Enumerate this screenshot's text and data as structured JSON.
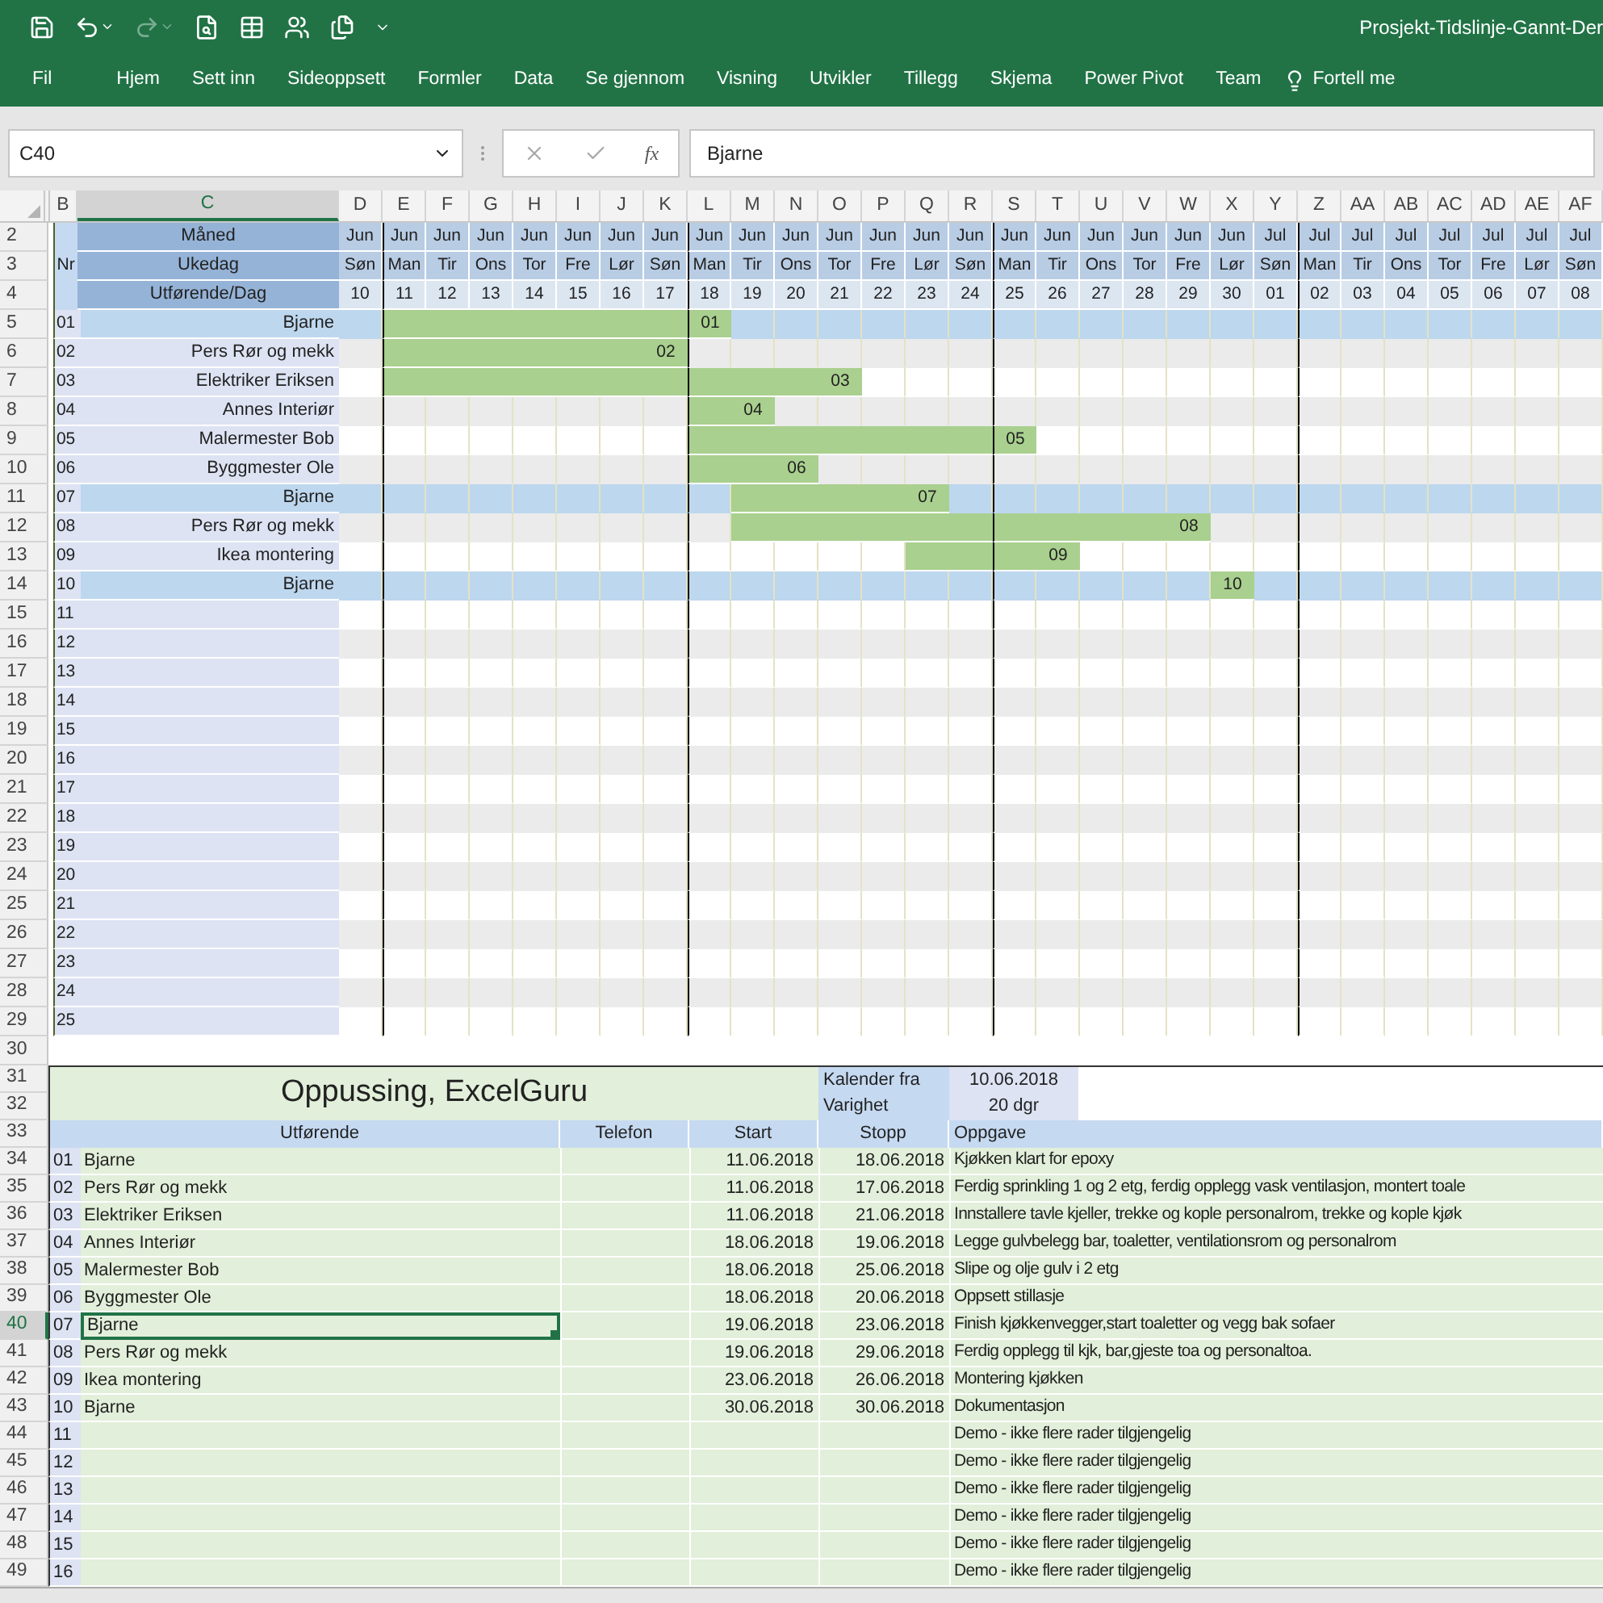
{
  "window": {
    "title": "Prosjekt-Tidslinje-Gannt-Der"
  },
  "quick_access": {
    "redo": {
      "disabled": true
    }
  },
  "ribbon_tabs": [
    {
      "label": "Fil"
    },
    {
      "label": "Hjem"
    },
    {
      "label": "Sett inn"
    },
    {
      "label": "Sideoppsett"
    },
    {
      "label": "Formler"
    },
    {
      "label": "Data"
    },
    {
      "label": "Se gjennom"
    },
    {
      "label": "Visning"
    },
    {
      "label": "Utvikler"
    },
    {
      "label": "Tillegg"
    },
    {
      "label": "Skjema"
    },
    {
      "label": "Power Pivot"
    },
    {
      "label": "Team"
    }
  ],
  "tell_me": "Fortell me",
  "formula_bar": {
    "name_box": "C40",
    "function_label": "fx",
    "value": "Bjarne"
  },
  "column_headers": [
    {
      "label": "B",
      "selected": false
    },
    {
      "label": "C",
      "selected": true
    },
    {
      "label": "D",
      "selected": false
    },
    {
      "label": "E",
      "selected": false
    },
    {
      "label": "F",
      "selected": false
    },
    {
      "label": "G",
      "selected": false
    },
    {
      "label": "H",
      "selected": false
    },
    {
      "label": "I",
      "selected": false
    },
    {
      "label": "J",
      "selected": false
    },
    {
      "label": "K",
      "selected": false
    },
    {
      "label": "L",
      "selected": false
    },
    {
      "label": "M",
      "selected": false
    },
    {
      "label": "N",
      "selected": false
    },
    {
      "label": "O",
      "selected": false
    },
    {
      "label": "P",
      "selected": false
    },
    {
      "label": "Q",
      "selected": false
    },
    {
      "label": "R",
      "selected": false
    },
    {
      "label": "S",
      "selected": false
    },
    {
      "label": "T",
      "selected": false
    },
    {
      "label": "U",
      "selected": false
    },
    {
      "label": "V",
      "selected": false
    },
    {
      "label": "W",
      "selected": false
    },
    {
      "label": "X",
      "selected": false
    },
    {
      "label": "Y",
      "selected": false
    },
    {
      "label": "Z",
      "selected": false
    },
    {
      "label": "AA",
      "selected": false
    },
    {
      "label": "AB",
      "selected": false
    },
    {
      "label": "AC",
      "selected": false
    },
    {
      "label": "AD",
      "selected": false
    },
    {
      "label": "AE",
      "selected": false
    },
    {
      "label": "AF",
      "selected": false
    }
  ],
  "row_headers": [
    {
      "label": "2",
      "selected": false
    },
    {
      "label": "3",
      "selected": false
    },
    {
      "label": "4",
      "selected": false
    },
    {
      "label": "5",
      "selected": false
    },
    {
      "label": "6",
      "selected": false
    },
    {
      "label": "7",
      "selected": false
    },
    {
      "label": "8",
      "selected": false
    },
    {
      "label": "9",
      "selected": false
    },
    {
      "label": "10",
      "selected": false
    },
    {
      "label": "11",
      "selected": false
    },
    {
      "label": "12",
      "selected": false
    },
    {
      "label": "13",
      "selected": false
    },
    {
      "label": "14",
      "selected": false
    },
    {
      "label": "15",
      "selected": false
    },
    {
      "label": "16",
      "selected": false
    },
    {
      "label": "17",
      "selected": false
    },
    {
      "label": "18",
      "selected": false
    },
    {
      "label": "19",
      "selected": false
    },
    {
      "label": "20",
      "selected": false
    },
    {
      "label": "21",
      "selected": false
    },
    {
      "label": "22",
      "selected": false
    },
    {
      "label": "23",
      "selected": false
    },
    {
      "label": "24",
      "selected": false
    },
    {
      "label": "25",
      "selected": false
    },
    {
      "label": "26",
      "selected": false
    },
    {
      "label": "27",
      "selected": false
    },
    {
      "label": "28",
      "selected": false
    },
    {
      "label": "29",
      "selected": false
    },
    {
      "label": "30",
      "selected": false
    },
    {
      "label": "31",
      "selected": false
    },
    {
      "label": "32",
      "selected": false
    },
    {
      "label": "33",
      "selected": false
    },
    {
      "label": "34",
      "selected": false
    },
    {
      "label": "35",
      "selected": false
    },
    {
      "label": "36",
      "selected": false
    },
    {
      "label": "37",
      "selected": false
    },
    {
      "label": "38",
      "selected": false
    },
    {
      "label": "39",
      "selected": false
    },
    {
      "label": "40",
      "selected": true
    },
    {
      "label": "41",
      "selected": false
    },
    {
      "label": "42",
      "selected": false
    },
    {
      "label": "43",
      "selected": false
    },
    {
      "label": "44",
      "selected": false
    },
    {
      "label": "45",
      "selected": false
    },
    {
      "label": "46",
      "selected": false
    },
    {
      "label": "47",
      "selected": false
    },
    {
      "label": "48",
      "selected": false
    },
    {
      "label": "49",
      "selected": false
    }
  ],
  "gantt": {
    "nr_label": "Nr",
    "month_label": "Måned",
    "weekday_label": "Ukedag",
    "day_label": "Utførende/Dag",
    "days": [
      {
        "month": "Jun",
        "weekday": "Søn",
        "day": "10",
        "week_start": false
      },
      {
        "month": "Jun",
        "weekday": "Man",
        "day": "11",
        "week_start": true
      },
      {
        "month": "Jun",
        "weekday": "Tir",
        "day": "12",
        "week_start": false
      },
      {
        "month": "Jun",
        "weekday": "Ons",
        "day": "13",
        "week_start": false
      },
      {
        "month": "Jun",
        "weekday": "Tor",
        "day": "14",
        "week_start": false
      },
      {
        "month": "Jun",
        "weekday": "Fre",
        "day": "15",
        "week_start": false
      },
      {
        "month": "Jun",
        "weekday": "Lør",
        "day": "16",
        "week_start": false
      },
      {
        "month": "Jun",
        "weekday": "Søn",
        "day": "17",
        "week_start": false
      },
      {
        "month": "Jun",
        "weekday": "Man",
        "day": "18",
        "week_start": true
      },
      {
        "month": "Jun",
        "weekday": "Tir",
        "day": "19",
        "week_start": false
      },
      {
        "month": "Jun",
        "weekday": "Ons",
        "day": "20",
        "week_start": false
      },
      {
        "month": "Jun",
        "weekday": "Tor",
        "day": "21",
        "week_start": false
      },
      {
        "month": "Jun",
        "weekday": "Fre",
        "day": "22",
        "week_start": false
      },
      {
        "month": "Jun",
        "weekday": "Lør",
        "day": "23",
        "week_start": false
      },
      {
        "month": "Jun",
        "weekday": "Søn",
        "day": "24",
        "week_start": false
      },
      {
        "month": "Jun",
        "weekday": "Man",
        "day": "25",
        "week_start": true
      },
      {
        "month": "Jun",
        "weekday": "Tir",
        "day": "26",
        "week_start": false
      },
      {
        "month": "Jun",
        "weekday": "Ons",
        "day": "27",
        "week_start": false
      },
      {
        "month": "Jun",
        "weekday": "Tor",
        "day": "28",
        "week_start": false
      },
      {
        "month": "Jun",
        "weekday": "Fre",
        "day": "29",
        "week_start": false
      },
      {
        "month": "Jun",
        "weekday": "Lør",
        "day": "30",
        "week_start": false
      },
      {
        "month": "Jul",
        "weekday": "Søn",
        "day": "01",
        "week_start": false
      },
      {
        "month": "Jul",
        "weekday": "Man",
        "day": "02",
        "week_start": true
      },
      {
        "month": "Jul",
        "weekday": "Tir",
        "day": "03",
        "week_start": false
      },
      {
        "month": "Jul",
        "weekday": "Ons",
        "day": "04",
        "week_start": false
      },
      {
        "month": "Jul",
        "weekday": "Tor",
        "day": "05",
        "week_start": false
      },
      {
        "month": "Jul",
        "weekday": "Fre",
        "day": "06",
        "week_start": false
      },
      {
        "month": "Jul",
        "weekday": "Lør",
        "day": "07",
        "week_start": false
      },
      {
        "month": "Jul",
        "weekday": "Søn",
        "day": "08",
        "week_start": false
      }
    ],
    "rows": [
      {
        "nr": "01",
        "name": "Bjarne",
        "highlighted": true,
        "bar_label": "01",
        "filled": [
          false,
          true,
          true,
          true,
          true,
          true,
          true,
          true,
          true,
          false,
          false,
          false,
          false,
          false,
          false,
          false,
          false,
          false,
          false,
          false,
          false,
          false,
          false,
          false,
          false,
          false,
          false,
          false,
          false
        ]
      },
      {
        "nr": "02",
        "name": "Pers Rør og mekk",
        "highlighted": false,
        "bar_label": "02",
        "filled": [
          false,
          true,
          true,
          true,
          true,
          true,
          true,
          true,
          false,
          false,
          false,
          false,
          false,
          false,
          false,
          false,
          false,
          false,
          false,
          false,
          false,
          false,
          false,
          false,
          false,
          false,
          false,
          false,
          false
        ]
      },
      {
        "nr": "03",
        "name": "Elektriker Eriksen",
        "highlighted": false,
        "bar_label": "03",
        "filled": [
          false,
          true,
          true,
          true,
          true,
          true,
          true,
          true,
          true,
          true,
          true,
          true,
          false,
          false,
          false,
          false,
          false,
          false,
          false,
          false,
          false,
          false,
          false,
          false,
          false,
          false,
          false,
          false,
          false
        ]
      },
      {
        "nr": "04",
        "name": "Annes Interiør",
        "highlighted": false,
        "bar_label": "04",
        "filled": [
          false,
          false,
          false,
          false,
          false,
          false,
          false,
          false,
          true,
          true,
          false,
          false,
          false,
          false,
          false,
          false,
          false,
          false,
          false,
          false,
          false,
          false,
          false,
          false,
          false,
          false,
          false,
          false,
          false
        ]
      },
      {
        "nr": "05",
        "name": "Malermester Bob",
        "highlighted": false,
        "bar_label": "05",
        "filled": [
          false,
          false,
          false,
          false,
          false,
          false,
          false,
          false,
          true,
          true,
          true,
          true,
          true,
          true,
          true,
          true,
          false,
          false,
          false,
          false,
          false,
          false,
          false,
          false,
          false,
          false,
          false,
          false,
          false
        ]
      },
      {
        "nr": "06",
        "name": "Byggmester Ole",
        "highlighted": false,
        "bar_label": "06",
        "filled": [
          false,
          false,
          false,
          false,
          false,
          false,
          false,
          false,
          true,
          true,
          true,
          false,
          false,
          false,
          false,
          false,
          false,
          false,
          false,
          false,
          false,
          false,
          false,
          false,
          false,
          false,
          false,
          false,
          false
        ]
      },
      {
        "nr": "07",
        "name": "Bjarne",
        "highlighted": true,
        "bar_label": "07",
        "filled": [
          false,
          false,
          false,
          false,
          false,
          false,
          false,
          false,
          false,
          true,
          true,
          true,
          true,
          true,
          false,
          false,
          false,
          false,
          false,
          false,
          false,
          false,
          false,
          false,
          false,
          false,
          false,
          false,
          false
        ]
      },
      {
        "nr": "08",
        "name": "Pers Rør og mekk",
        "highlighted": false,
        "bar_label": "08",
        "filled": [
          false,
          false,
          false,
          false,
          false,
          false,
          false,
          false,
          false,
          true,
          true,
          true,
          true,
          true,
          true,
          true,
          true,
          true,
          true,
          true,
          false,
          false,
          false,
          false,
          false,
          false,
          false,
          false,
          false
        ]
      },
      {
        "nr": "09",
        "name": "Ikea montering",
        "highlighted": false,
        "bar_label": "09",
        "filled": [
          false,
          false,
          false,
          false,
          false,
          false,
          false,
          false,
          false,
          false,
          false,
          false,
          false,
          true,
          true,
          true,
          true,
          false,
          false,
          false,
          false,
          false,
          false,
          false,
          false,
          false,
          false,
          false,
          false
        ]
      },
      {
        "nr": "10",
        "name": "Bjarne",
        "highlighted": true,
        "bar_label": "10",
        "filled": [
          false,
          false,
          false,
          false,
          false,
          false,
          false,
          false,
          false,
          false,
          false,
          false,
          false,
          false,
          false,
          false,
          false,
          false,
          false,
          false,
          true,
          false,
          false,
          false,
          false,
          false,
          false,
          false,
          false
        ]
      },
      {
        "nr": "11",
        "highlighted": false
      },
      {
        "nr": "12",
        "highlighted": false
      },
      {
        "nr": "13",
        "highlighted": false
      },
      {
        "nr": "14",
        "highlighted": false
      },
      {
        "nr": "15",
        "highlighted": false
      },
      {
        "nr": "16",
        "highlighted": false
      },
      {
        "nr": "17",
        "highlighted": false
      },
      {
        "nr": "18",
        "highlighted": false
      },
      {
        "nr": "19",
        "highlighted": false
      },
      {
        "nr": "20",
        "highlighted": false
      },
      {
        "nr": "21",
        "highlighted": false
      },
      {
        "nr": "22",
        "highlighted": false
      },
      {
        "nr": "23",
        "highlighted": false
      },
      {
        "nr": "24",
        "highlighted": false
      },
      {
        "nr": "25",
        "highlighted": false
      }
    ]
  },
  "summary": {
    "title": "Oppussing, ExcelGuru",
    "calendar_label": "Kalender fra",
    "calendar_value": "10.06.2018",
    "duration_label": "Varighet",
    "duration_value": "20 dgr",
    "columns": [
      "Utførende",
      "Telefon",
      "Start",
      "Stopp",
      "Oppgave"
    ],
    "rows": [
      {
        "nr": "01",
        "name": "Bjarne",
        "start": "11.06.2018",
        "stop": "18.06.2018",
        "task": "Kjøkken klart for epoxy",
        "selected": false
      },
      {
        "nr": "02",
        "name": "Pers Rør og mekk",
        "start": "11.06.2018",
        "stop": "17.06.2018",
        "task": "Ferdig sprinkling 1 og 2 etg, ferdig opplegg vask ventilasjon, montert toale",
        "selected": false
      },
      {
        "nr": "03",
        "name": "Elektriker Eriksen",
        "start": "11.06.2018",
        "stop": "21.06.2018",
        "task": "Innstallere tavle kjeller, trekke og kople personalrom, trekke og kople kjøk",
        "selected": false
      },
      {
        "nr": "04",
        "name": "Annes Interiør",
        "start": "18.06.2018",
        "stop": "19.06.2018",
        "task": "Legge gulvbelegg bar, toaletter, ventilationsrom og personalrom",
        "selected": false
      },
      {
        "nr": "05",
        "name": "Malermester Bob",
        "start": "18.06.2018",
        "stop": "25.06.2018",
        "task": "Slipe og olje gulv i 2 etg",
        "selected": false
      },
      {
        "nr": "06",
        "name": "Byggmester Ole",
        "start": "18.06.2018",
        "stop": "20.06.2018",
        "task": "Oppsett stillasje",
        "selected": false
      },
      {
        "nr": "07",
        "name": "Bjarne",
        "start": "19.06.2018",
        "stop": "23.06.2018",
        "task": "Finish kjøkkenvegger,start toaletter og vegg bak sofaer",
        "selected": true
      },
      {
        "nr": "08",
        "name": "Pers Rør og mekk",
        "start": "19.06.2018",
        "stop": "29.06.2018",
        "task": "Ferdig opplegg til kjk, bar,gjeste toa og personaltoa.",
        "selected": false
      },
      {
        "nr": "09",
        "name": "Ikea montering",
        "start": "23.06.2018",
        "stop": "26.06.2018",
        "task": "Montering kjøkken",
        "selected": false
      },
      {
        "nr": "10",
        "name": "Bjarne",
        "start": "30.06.2018",
        "stop": "30.06.2018",
        "task": "Dokumentasjon",
        "selected": false
      },
      {
        "nr": "11",
        "task": "Demo - ikke flere rader tilgjengelig",
        "selected": false
      },
      {
        "nr": "12",
        "task": "Demo - ikke flere rader tilgjengelig",
        "selected": false
      },
      {
        "nr": "13",
        "task": "Demo - ikke flere rader tilgjengelig",
        "selected": false
      },
      {
        "nr": "14",
        "task": "Demo - ikke flere rader tilgjengelig",
        "selected": false
      },
      {
        "nr": "15",
        "task": "Demo - ikke flere rader tilgjengelig",
        "selected": false
      },
      {
        "nr": "16",
        "task": "Demo - ikke flere rader tilgjengelig",
        "selected": false
      }
    ]
  }
}
